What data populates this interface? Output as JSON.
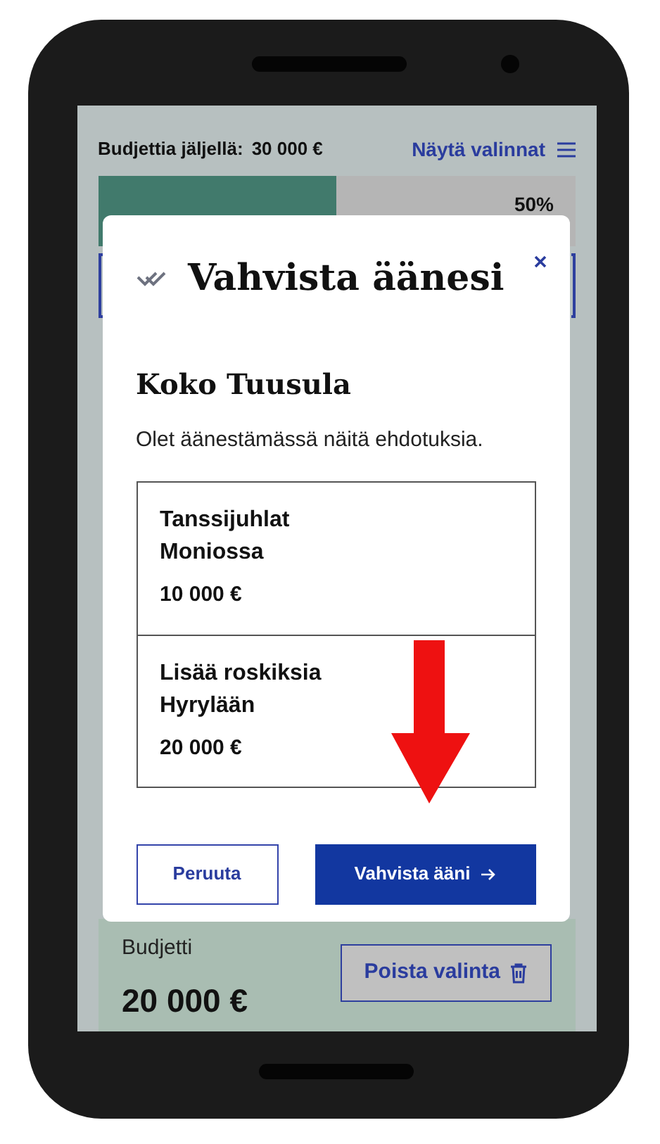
{
  "header": {
    "budget_label": "Budjettia jäljellä:",
    "budget_value": "30 000 €",
    "show_selections": "Näytä valinnat"
  },
  "progress": {
    "level": 0.5,
    "reading": "50%"
  },
  "budget_card": {
    "label": "Budjetti",
    "amount": "20 000 €",
    "remove_button": "Poista valinta"
  },
  "dialog": {
    "title": "Vahvista äänesi",
    "area": "Koko Tuusula",
    "intro": "Olet äänestämässä näitä ehdotuksia.",
    "proposals": [
      {
        "name": "Tanssijuhlat Moniossa",
        "amount": "10 000 €"
      },
      {
        "name": "Lisää roskiksia Hyrylään",
        "amount": "20 000 €"
      }
    ],
    "cancel_button": "Peruuta",
    "confirm_button": "Vahvista ääni"
  }
}
